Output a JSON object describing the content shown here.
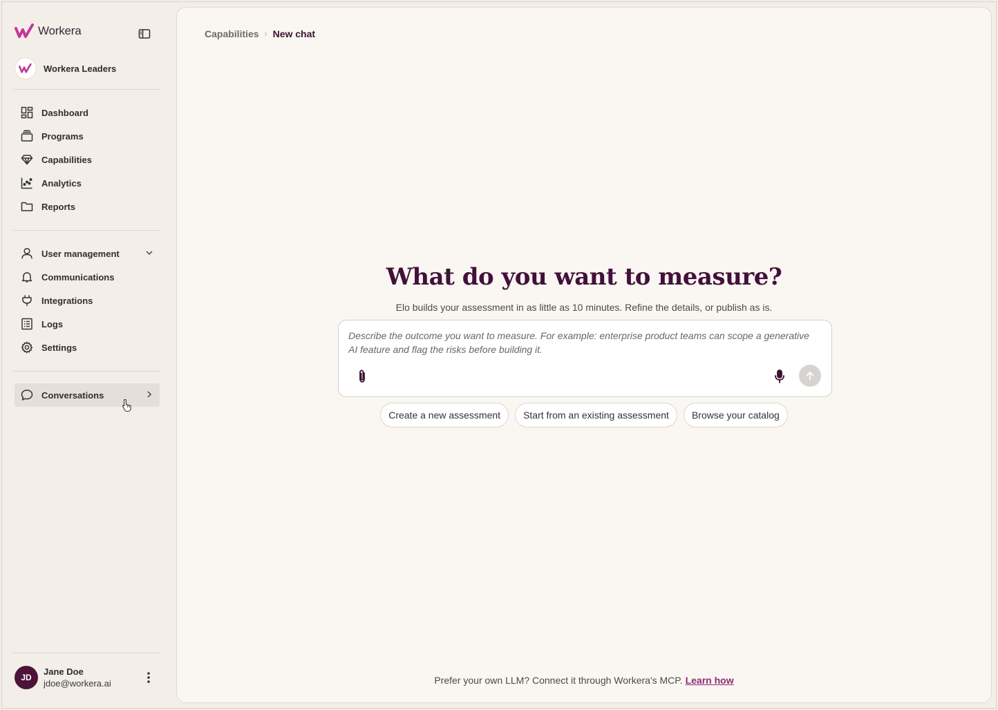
{
  "brand": {
    "name": "Workera",
    "accent": "#c0399a"
  },
  "org": {
    "name": "Workera Leaders"
  },
  "nav_primary": [
    {
      "label": "Dashboard",
      "icon": "dashboard-icon"
    },
    {
      "label": "Programs",
      "icon": "stack-icon"
    },
    {
      "label": "Capabilities",
      "icon": "diamond-icon"
    },
    {
      "label": "Analytics",
      "icon": "chart-icon"
    },
    {
      "label": "Reports",
      "icon": "folder-icon"
    }
  ],
  "nav_admin": [
    {
      "label": "User management",
      "icon": "user-icon"
    },
    {
      "label": "Communications",
      "icon": "bell-icon"
    },
    {
      "label": "Integrations",
      "icon": "plug-icon"
    },
    {
      "label": "Logs",
      "icon": "list-icon"
    },
    {
      "label": "Settings",
      "icon": "gear-icon"
    }
  ],
  "conversations": {
    "label": "Conversations"
  },
  "user": {
    "initials": "JD",
    "name": "Jane Doe",
    "email": "jdoe@workera.ai"
  },
  "breadcrumb": {
    "parent": "Capabilities",
    "current": "New chat"
  },
  "main": {
    "headline": "What do you want to measure?",
    "subline": "Elo builds your assessment in as little as 10 minutes. Refine the details, or publish as is.",
    "input_placeholder": "Describe the outcome you want to measure. For example: enterprise product teams can scope a generative AI feature and flag the risks before building it.",
    "chips": [
      "Create a new assessment",
      "Start from an existing assessment",
      "Browse your catalog"
    ],
    "footer_text": "Prefer your own LLM? Connect it through Workera's MCP.",
    "footer_link": "Learn how"
  },
  "colors": {
    "primary_dark": "#42113a",
    "avatar_bg": "#4b1438"
  }
}
